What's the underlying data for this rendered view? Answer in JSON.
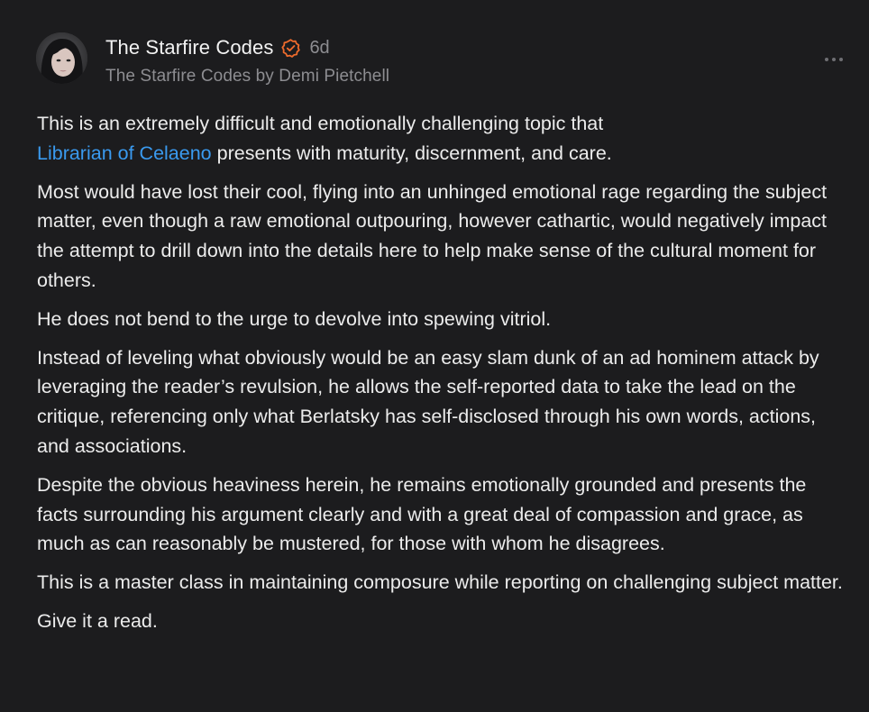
{
  "author": {
    "name": "The Starfire Codes",
    "verified_icon": "verified-badge-icon",
    "timestamp": "6d",
    "publication_line": "The Starfire Codes by Demi Pietchell"
  },
  "more_menu": {
    "icon": "ellipsis-icon"
  },
  "colors": {
    "background": "#1c1c1e",
    "text": "#ececec",
    "muted": "#8d8d91",
    "mention": "#3a9aef",
    "verified": "#ee6b2c"
  },
  "post": {
    "p1_before": "This is an extremely difficult and emotionally challenging topic that",
    "p1_mention": "Librarian of Celaeno",
    "p1_after": "presents with maturity, discernment, and care.",
    "p2": "Most would have lost their cool, flying into an unhinged emotional rage regarding the subject matter, even though a raw emotional outpouring, however cathartic, would negatively impact the attempt to drill down into the details here to help make sense of the cultural moment for others.",
    "p3": "He does not bend to the urge to devolve into spewing vitriol.",
    "p4": "Instead of leveling what obviously would be an easy slam dunk of an ad hominem attack by leveraging the reader’s revulsion, he allows the self-reported data to take the lead on the critique, referencing only what Berlatsky has self-disclosed through his own words, actions, and associations.",
    "p5": "Despite the obvious heaviness herein, he remains emotionally grounded and presents the facts surrounding his argument clearly and with a great deal of compassion and grace, as much as can reasonably be mustered, for those with whom he disagrees.",
    "p6": "This is a master class in maintaining composure while reporting on challenging subject matter.",
    "p7": "Give it a read."
  }
}
